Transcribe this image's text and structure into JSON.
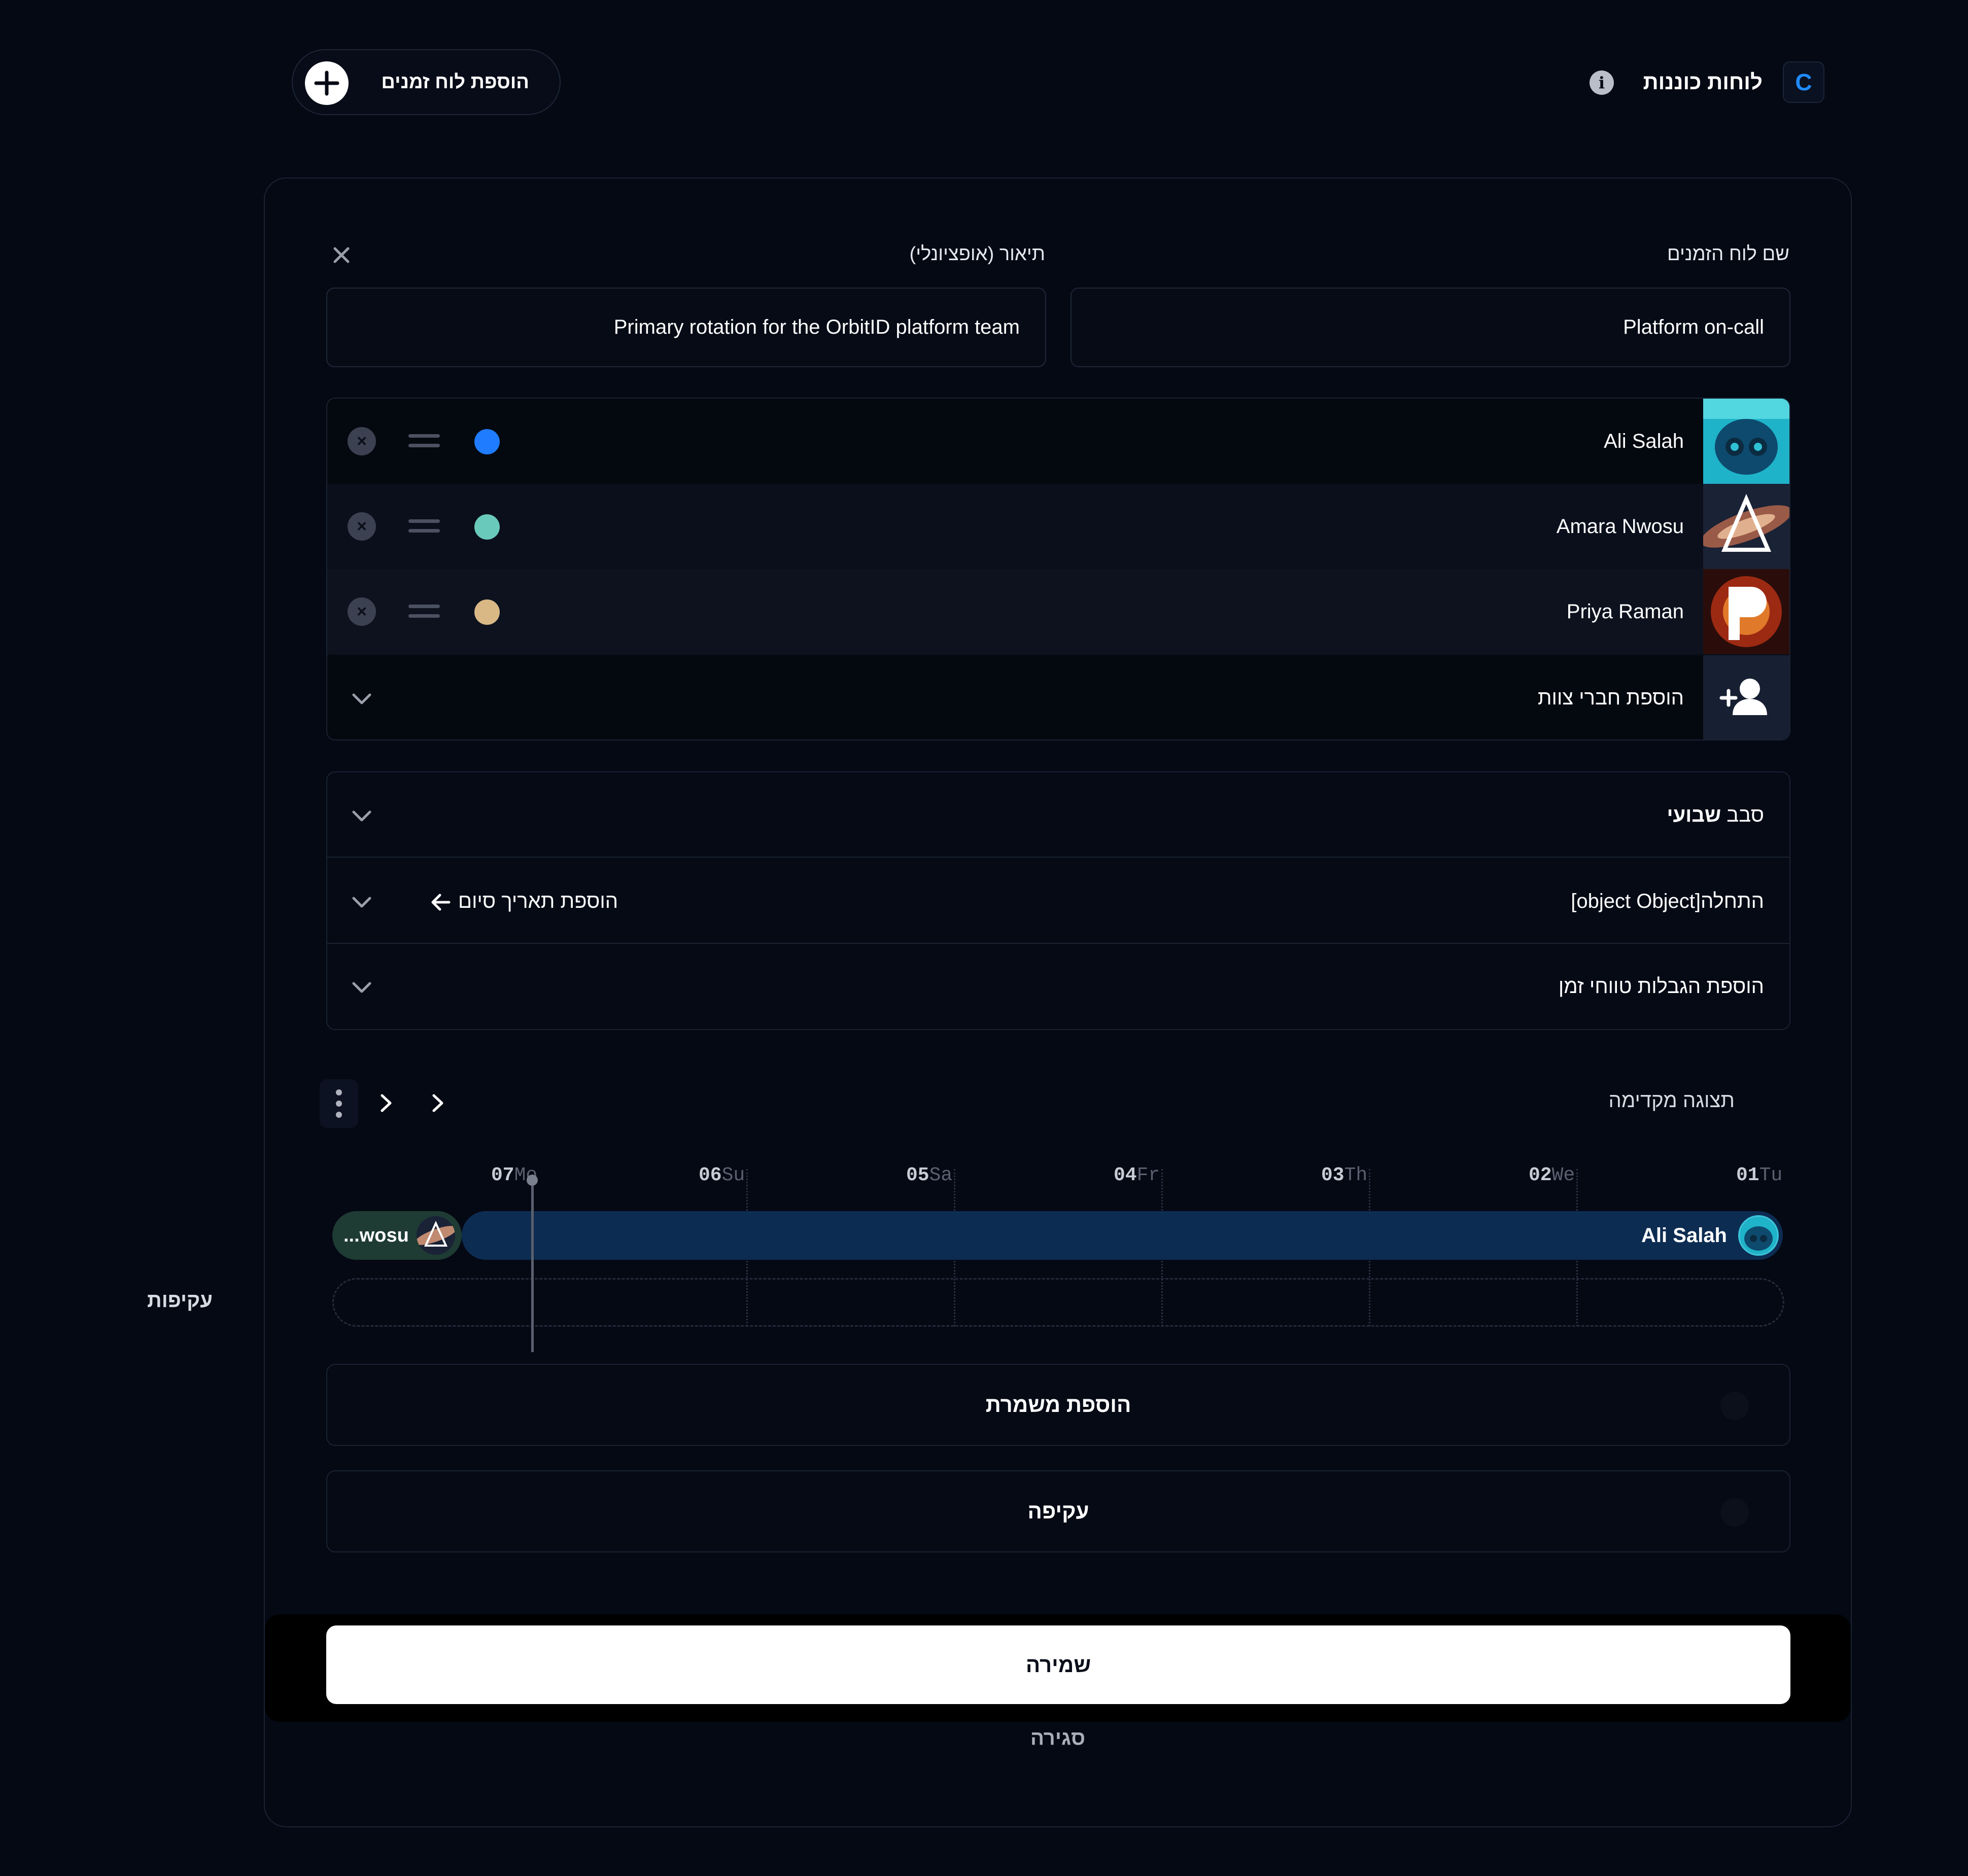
{
  "header": {
    "logo_letter": "C",
    "app_title": "לוחות כוננות",
    "add_schedule_label": "הוספת לוח זמנים"
  },
  "form": {
    "name_label": "שם לוח הזמנים",
    "name_value": "Platform on-call",
    "description_label": "תיאור (אופציונלי)",
    "description_value": "Primary rotation for the OrbitID platform team"
  },
  "members": [
    {
      "name": "Ali Salah",
      "color": "#1f7cff"
    },
    {
      "name": "Amara Nwosu",
      "color": "#69c9bb"
    },
    {
      "name": "Priya Raman",
      "color": "#d9b886"
    }
  ],
  "add_members_label": "הוספת חברי צוות",
  "settings": {
    "rotation_prefix": "סבב",
    "rotation_type": "שבועי",
    "start_text": "[object Object]התחלה",
    "add_end_date": "הוספת תאריך סיום",
    "add_restrictions": "הוספת הגבלות טווחי זמן"
  },
  "preview": {
    "title": "תצוגה מקדימה",
    "ticks": [
      {
        "day": "07",
        "abbr": "Mo"
      },
      {
        "day": "06",
        "abbr": "Su"
      },
      {
        "day": "05",
        "abbr": "Sa"
      },
      {
        "day": "04",
        "abbr": "Fr"
      },
      {
        "day": "03",
        "abbr": "Th"
      },
      {
        "day": "02",
        "abbr": "We"
      },
      {
        "day": "01",
        "abbr": "Tu"
      }
    ],
    "shift_main_label": "Ali Salah",
    "shift_second_label": "...wosu",
    "overrides_label": "עקיפות"
  },
  "add_shift_label": "הוספת משמרת",
  "override_label": "עקיפה",
  "save_label": "שמירה",
  "close_label": "סגירה"
}
